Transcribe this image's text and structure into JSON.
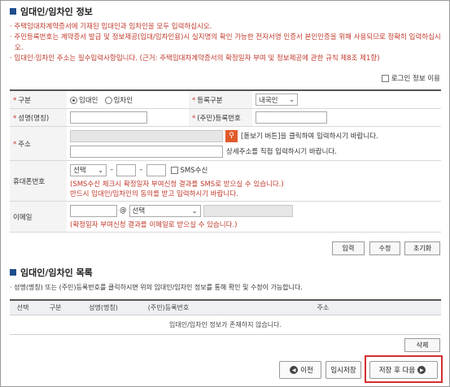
{
  "section1": {
    "title": "임대인/임차인 정보",
    "notices": [
      "주택임대차계약증서에 기재된 임대인과 임차인을 모두 입력하십시오.",
      "주민등록번호는 계약증서 발급 및 정보제공(임대/임차인용)시 실지명의 확인 가능한 전자서명 인증서 본인인증을 위해 사용되므로 정확히 입력하십시오.",
      "임대인·임차인 주소는 필수입력사항입니다. (근거: 주택임대차계약증서의 확정일자 부여 및 정보제공에 관한 규칙 제8조 제1항)"
    ],
    "login_info_checkbox": "로그인 정보 이용"
  },
  "form": {
    "type_label": "구분",
    "type_options": [
      "임대인",
      "임차인"
    ],
    "type_selected": "임대인",
    "reg_type_label": "등록구분",
    "reg_type_value": "내국인",
    "name_label": "성명(명칭)",
    "idnum_label": "(주민)등록번호",
    "address_label": "주소",
    "address_search_hint": "[돋보기 버튼]을 클릭하여 입력하시기 바랍니다.",
    "address_detail_hint": "상세주소를 직접 입력하시기 바랍니다.",
    "phone_label": "휴대폰번호",
    "phone_select": "선택",
    "sms_label": "SMS수신",
    "phone_note1": "(SMS수신 체크시 확정일자 부여신청 결과를 SMS로 받으실 수 있습니다.)",
    "phone_note2": "반드시 임대인/임차인의 동의를 받고 입력하시기 바랍니다.",
    "email_label": "이메일",
    "email_at": "@",
    "email_select": "선택",
    "email_note": "(확정일자 부여신청 결과를 이메일로 받으실 수 있습니다.)"
  },
  "form_buttons": {
    "input": "입력",
    "edit": "수정",
    "reset": "초기화"
  },
  "section2": {
    "title": "임대인/임차인 목록",
    "notice": "성명(명칭) 또는 (주민)등록번호를 클릭하시면 위의 임대인/임차인 정보를 통해 확인 및 수정이 가능합니다.",
    "columns": [
      "선택",
      "구분",
      "성명(명칭)",
      "(주민)등록번호",
      "주소"
    ],
    "empty_message": "임대인/임차인 정보가 존재하지 않습니다.",
    "delete_button": "삭제"
  },
  "nav": {
    "prev": "이전",
    "temp_save": "임시저장",
    "save_next": "저장 후 다음"
  }
}
